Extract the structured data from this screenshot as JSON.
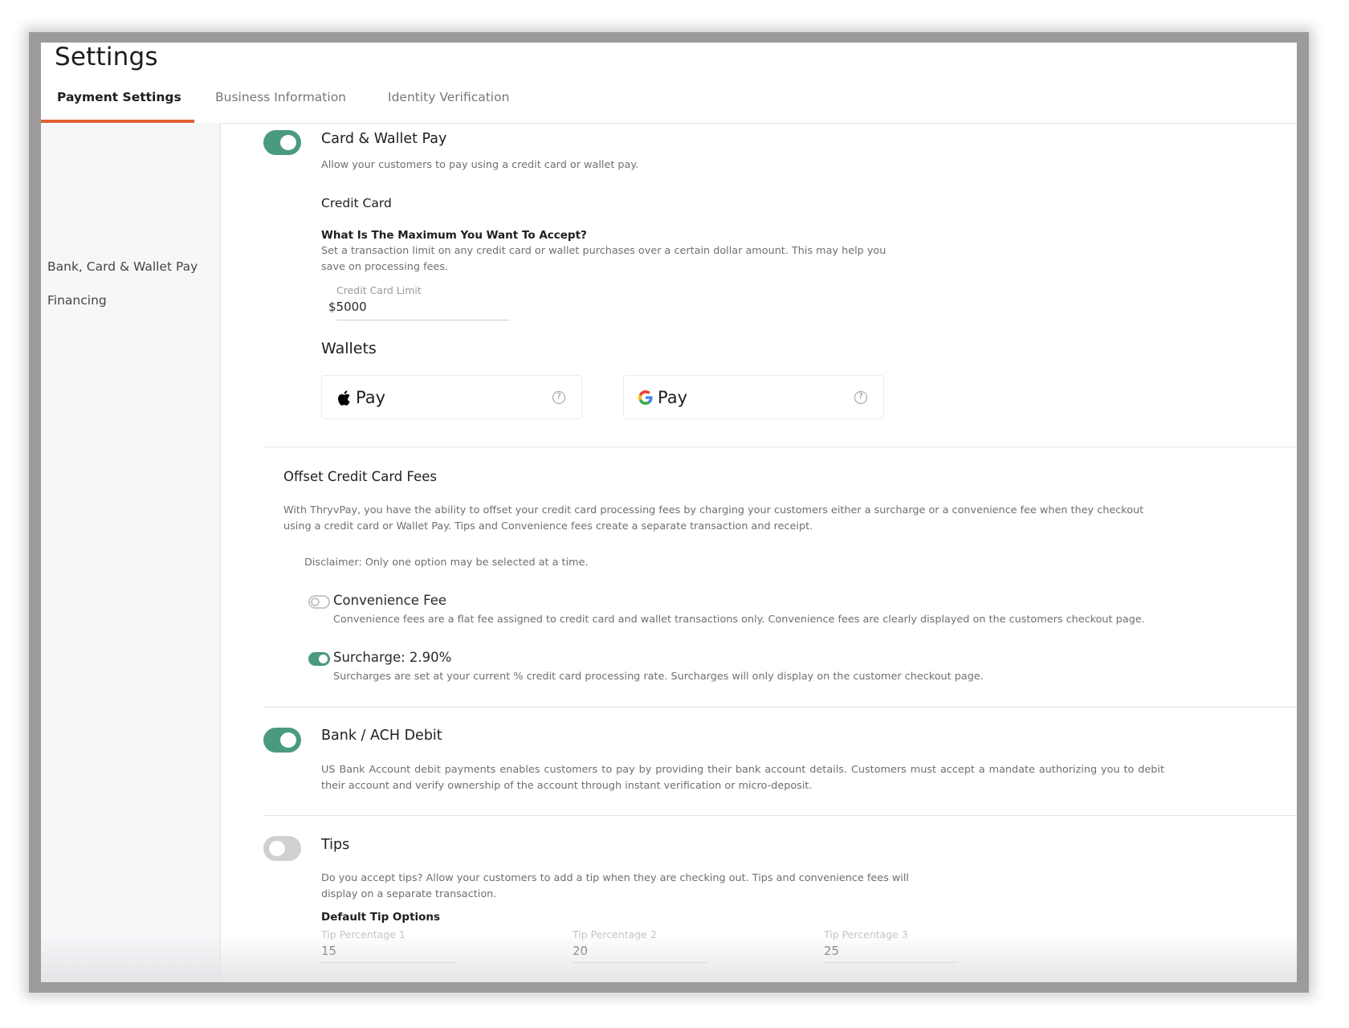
{
  "header": {
    "title": "Settings"
  },
  "tabs": [
    {
      "label": "Payment Settings",
      "active": true
    },
    {
      "label": "Business Information",
      "active": false
    },
    {
      "label": "Identity Verification",
      "active": false
    }
  ],
  "sidebar": {
    "items": [
      {
        "label": "Bank, Card & Wallet Pay"
      },
      {
        "label": "Financing"
      }
    ]
  },
  "colors": {
    "accent": "#e0622f",
    "toggle_on": "#4a9a7f",
    "toggle_off": "#d0d0d0"
  },
  "card_wallet": {
    "enabled": true,
    "title": "Card & Wallet Pay",
    "description": "Allow your customers to pay using a credit card or wallet pay.",
    "credit_card_heading": "Credit Card",
    "max_question": "What Is The Maximum You Want To Accept?",
    "max_description": "Set a transaction limit on any credit card or wallet purchases over a certain dollar amount. This may help you save on processing fees.",
    "limit_field": {
      "label": "Credit Card Limit",
      "prefix": "$",
      "value": "5000"
    },
    "wallets_heading": "Wallets",
    "wallets": [
      {
        "name": "Apple Pay",
        "label": "Pay",
        "icon": "apple-icon",
        "help_icon": "?"
      },
      {
        "name": "Google Pay",
        "label": "Pay",
        "icon": "google-icon",
        "help_icon": "?"
      }
    ]
  },
  "offset_fees": {
    "title": "Offset Credit Card Fees",
    "description": "With ThryvPay, you have the ability to offset your credit card processing fees by charging your customers either a surcharge or a convenience fee when they checkout using a credit card or Wallet Pay. Tips and Convenience fees create a separate transaction and receipt.",
    "disclaimer": "Disclaimer: Only one option may be selected at a time.",
    "options": [
      {
        "label": "Convenience Fee",
        "enabled": false,
        "description": "Convenience fees are a flat fee assigned to credit card and wallet transactions only. Convenience fees are clearly displayed on the customers checkout page."
      },
      {
        "label": "Surcharge: 2.90%",
        "enabled": true,
        "description": "Surcharges are set at your current % credit card processing rate. Surcharges will only display on the customer checkout page."
      }
    ]
  },
  "bank_ach": {
    "enabled": true,
    "title": "Bank / ACH Debit",
    "description": "US Bank Account debit payments enables customers to pay by providing their bank account details. Customers must accept a mandate authorizing you to debit their account and verify ownership of the account through instant verification or micro-deposit."
  },
  "tips": {
    "enabled": false,
    "title": "Tips",
    "description": "Do you accept tips? Allow your customers to add a tip when they are checking out. Tips and convenience fees will display on a separate transaction.",
    "default_heading": "Default Tip Options",
    "fields": [
      {
        "label": "Tip Percentage 1",
        "value": "15"
      },
      {
        "label": "Tip Percentage 2",
        "value": "20"
      },
      {
        "label": "Tip Percentage 3",
        "value": "25"
      }
    ]
  }
}
